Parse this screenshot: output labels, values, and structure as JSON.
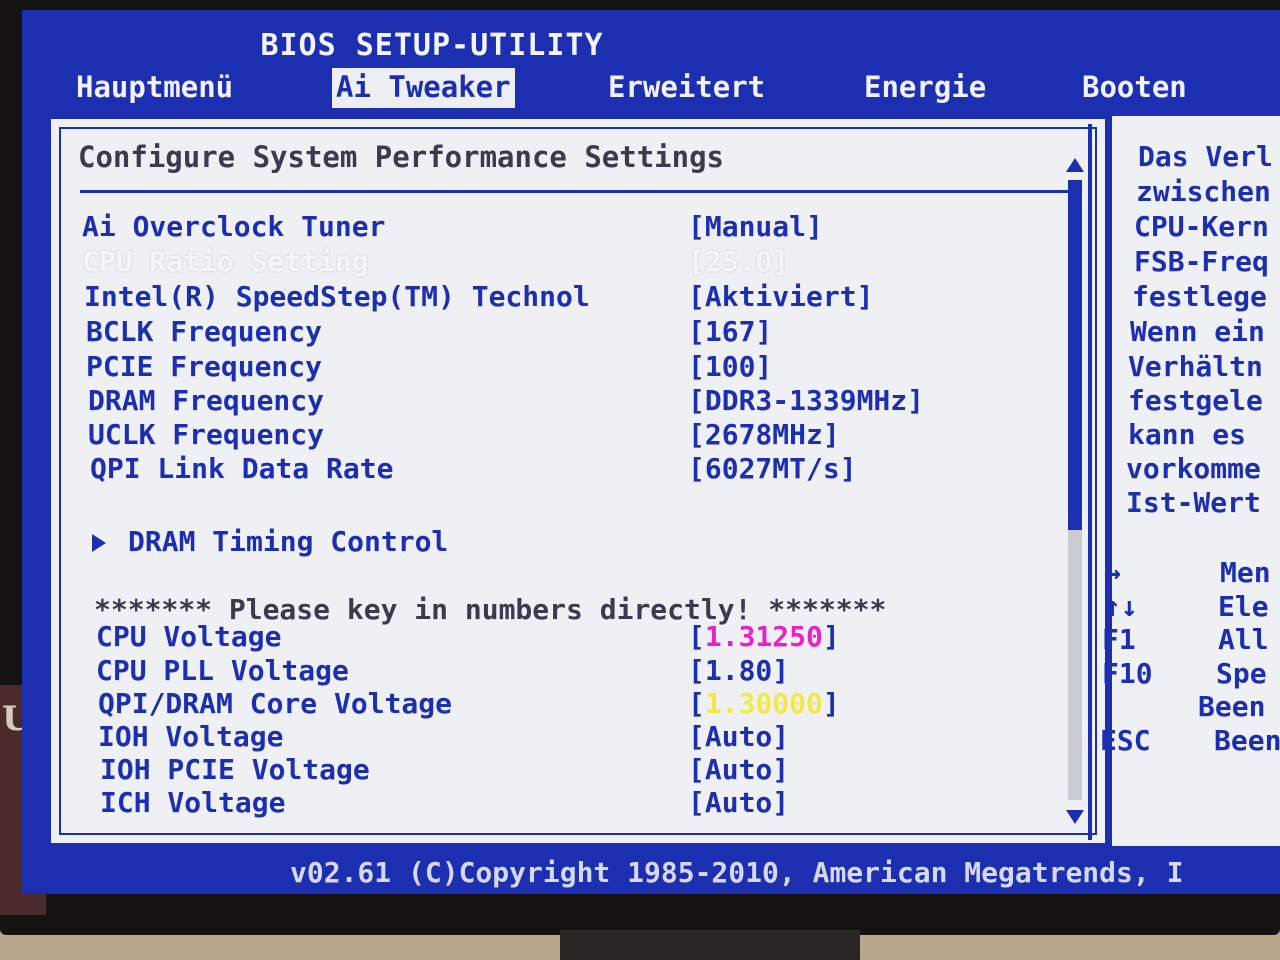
{
  "title": "BIOS SETUP-UTILITY",
  "menu": [
    "Hauptmenü",
    "Ai Tweaker",
    "Erweitert",
    "Energie",
    "Booten"
  ],
  "active_menu": "Ai Tweaker",
  "heading": "Configure System Performance Settings",
  "settings": [
    {
      "label": "Ai Overclock Tuner",
      "value": "[Manual]"
    },
    {
      "label": "CPU Ratio Setting",
      "value": "[25.0]"
    },
    {
      "label": "Intel(R) SpeedStep(TM) Technol",
      "value": "[Aktiviert]"
    },
    {
      "label": "BCLK Frequency",
      "value": "[167]"
    },
    {
      "label": "PCIE Frequency",
      "value": "[100]"
    },
    {
      "label": "DRAM Frequency",
      "value": "[DDR3-1339MHz]"
    },
    {
      "label": "UCLK Frequency",
      "value": "[2678MHz]"
    },
    {
      "label": "QPI Link Data Rate",
      "value": "[6027MT/s]"
    }
  ],
  "submenu": "DRAM Timing Control",
  "note": "******* Please key in numbers directly! *******",
  "voltages": [
    {
      "label": "CPU Voltage",
      "value_open": "[",
      "value": "1.31250",
      "value_close": "]",
      "color": "#e822c8"
    },
    {
      "label": "CPU PLL Voltage",
      "value_open": "[",
      "value": "1.80",
      "value_close": "]",
      "color": ""
    },
    {
      "label": "QPI/DRAM Core Voltage",
      "value_open": "[",
      "value": "1.30000",
      "value_close": "]",
      "color": "#f1e84a"
    },
    {
      "label": "IOH Voltage",
      "value_open": "[",
      "value": "Auto",
      "value_close": "]",
      "color": ""
    },
    {
      "label": "IOH PCIE Voltage",
      "value_open": "[",
      "value": "Auto",
      "value_close": "]",
      "color": ""
    },
    {
      "label": "ICH Voltage",
      "value_open": "[",
      "value": "Auto",
      "value_close": "]",
      "color": ""
    }
  ],
  "help_text": [
    "Das Verl",
    "zwischen",
    "CPU-Kern",
    "FSB-Freq",
    "festlege",
    "Wenn ein",
    "Verhältn",
    "festgele",
    "kann es",
    "vorkomme",
    "Ist-Wert"
  ],
  "keys": [
    {
      "key": "↔",
      "desc": "Men"
    },
    {
      "key": "↑↓",
      "desc": "Ele"
    },
    {
      "key": "F1",
      "desc": "All"
    },
    {
      "key": "F10",
      "desc": "Spe"
    },
    {
      "key": "",
      "desc": "Been"
    },
    {
      "key": "ESC",
      "desc": "Been"
    }
  ],
  "footer": "v02.61 (C)Copyright 1985-2010, American Megatrends, I",
  "box_text": "UDI",
  "colors": {
    "bios_blue": "#1c2fb0",
    "panel_bg": "#eef0f3",
    "highlight": "#f6f6f8"
  }
}
